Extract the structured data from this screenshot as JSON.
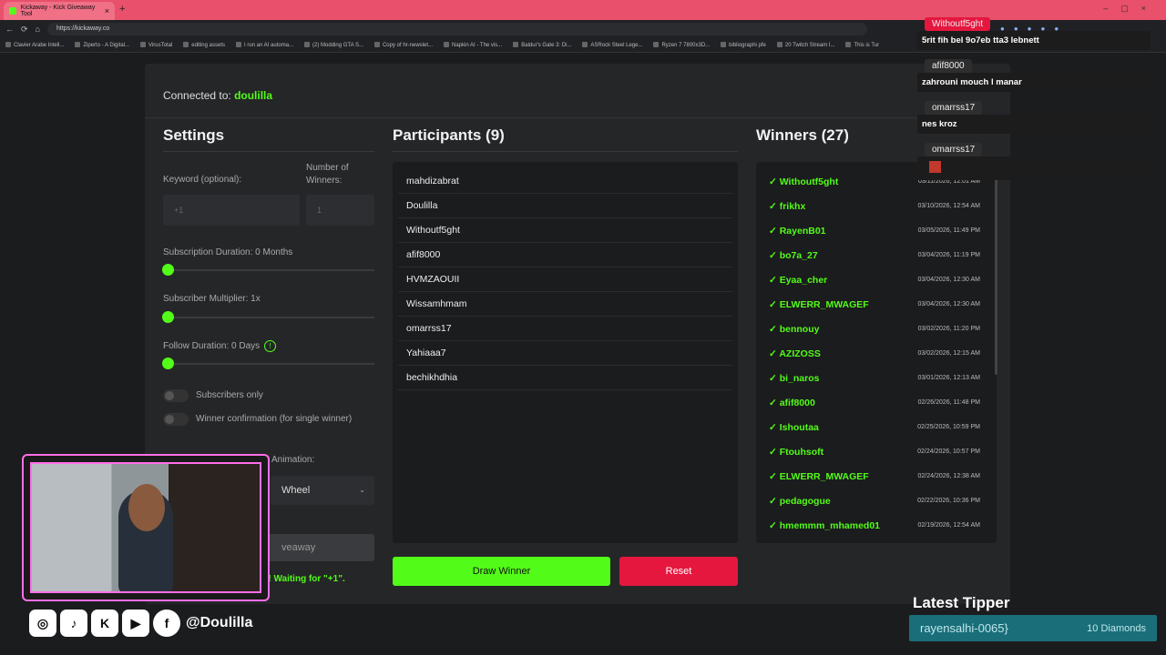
{
  "browser": {
    "tab_title": "Kickaway - Kick Giveaway Tool",
    "url": "https://kickaway.co",
    "bookmarks": [
      "Clavier Arabe Intell...",
      "Ziperto - A Digital...",
      "VirusTotal",
      "editing assets",
      "I run an AI automa...",
      "(2) Modding GTA S...",
      "Copy of hr-newslet...",
      "Napkin AI - The vis...",
      "Baldur's Gate 3: Di...",
      "ASRock Steel Lege...",
      "Ryzen 7 7800x3D...",
      "bibliographi pfe",
      "20 Twitch Stream I...",
      "This is Tur"
    ]
  },
  "app": {
    "connected_label": "Connected to:",
    "channel": "doulilla",
    "settings": {
      "title": "Settings",
      "keyword_label": "Keyword (optional):",
      "keyword_placeholder": "+1",
      "winners_label": "Number of Winners:",
      "winners_placeholder": "1",
      "sub_duration": "Subscription Duration: 0 Months",
      "sub_duration_value": 0,
      "sub_multiplier": "Subscriber Multiplier: 1x",
      "sub_multiplier_value": 1,
      "follow_duration": "Follow Duration:  0  Days",
      "follow_duration_value": 0,
      "info_icon": "!",
      "subs_only": "Subscribers only",
      "winner_confirm": "Winner confirmation (for single winner)",
      "animation_label": "Animation:",
      "animation_value": "Wheel",
      "start_label": "veaway",
      "status": "t! Waiting for \"+1\"."
    },
    "participants": {
      "title": "Participants (9)",
      "items": [
        "mahdizabrat",
        "Doulilla",
        "Withoutf5ght",
        "afif8000",
        "HVMZAOUII",
        "Wissamhmam",
        "omarrss17",
        "Yahiaaa7",
        "bechikhdhia"
      ]
    },
    "draw_label": "Draw Winner",
    "reset_label": "Reset",
    "winners": {
      "title": "Winners (27)",
      "items": [
        {
          "name": "✓ Withoutf5ght",
          "date": "03/11/2026, 12:01 AM"
        },
        {
          "name": "✓ frikhx",
          "date": "03/10/2026, 12:54 AM"
        },
        {
          "name": "✓ RayenB01",
          "date": "03/05/2026, 11:49 PM"
        },
        {
          "name": "✓ bo7a_27",
          "date": "03/04/2026, 11:19 PM"
        },
        {
          "name": "✓ Eyaa_cher",
          "date": "03/04/2026, 12:30 AM"
        },
        {
          "name": "✓ ELWERR_MWAGEF",
          "date": "03/04/2026, 12:30 AM"
        },
        {
          "name": "✓ bennouy",
          "date": "03/02/2026, 11:20 PM"
        },
        {
          "name": "✓ AZIZOSS",
          "date": "03/02/2026, 12:15 AM"
        },
        {
          "name": "✓ bi_naros",
          "date": "03/01/2026, 12:13 AM"
        },
        {
          "name": "✓ afif8000",
          "date": "02/26/2026, 11:48 PM"
        },
        {
          "name": "✓ Ishoutaa",
          "date": "02/25/2026, 10:59 PM"
        },
        {
          "name": "✓ Ftouhsoft",
          "date": "02/24/2026, 10:57 PM"
        },
        {
          "name": "✓ ELWERR_MWAGEF",
          "date": "02/24/2026, 12:38 AM"
        },
        {
          "name": "✓ pedagogue",
          "date": "02/22/2026, 10:36 PM"
        },
        {
          "name": "✓ hmemmm_mhamed01",
          "date": "02/19/2026, 12:54 AM"
        }
      ]
    }
  },
  "chat": [
    {
      "user": "Withoutf5ght",
      "text": "5rit fih bel 9o7eb tta3 lebnett"
    },
    {
      "user": "afif8000",
      "text": "zahrouni mouch l manar"
    },
    {
      "user": "omarrss17",
      "text": "nes kroz"
    },
    {
      "user": "omarrss17",
      "text": ""
    }
  ],
  "overlay": {
    "handle": "@Doulilla",
    "social_icons": [
      "instagram-icon",
      "tiktok-icon",
      "kick-icon",
      "youtube-icon",
      "facebook-icon"
    ],
    "tipper_title": "Latest Tipper",
    "tipper_name": "rayensalhi-0065}",
    "tipper_amount": "10 Diamonds"
  },
  "colors": {
    "accent": "#53fc18",
    "danger": "#e5173f",
    "cam_border": "#ff6ee8",
    "tipper_bg": "#1a6e7a"
  }
}
